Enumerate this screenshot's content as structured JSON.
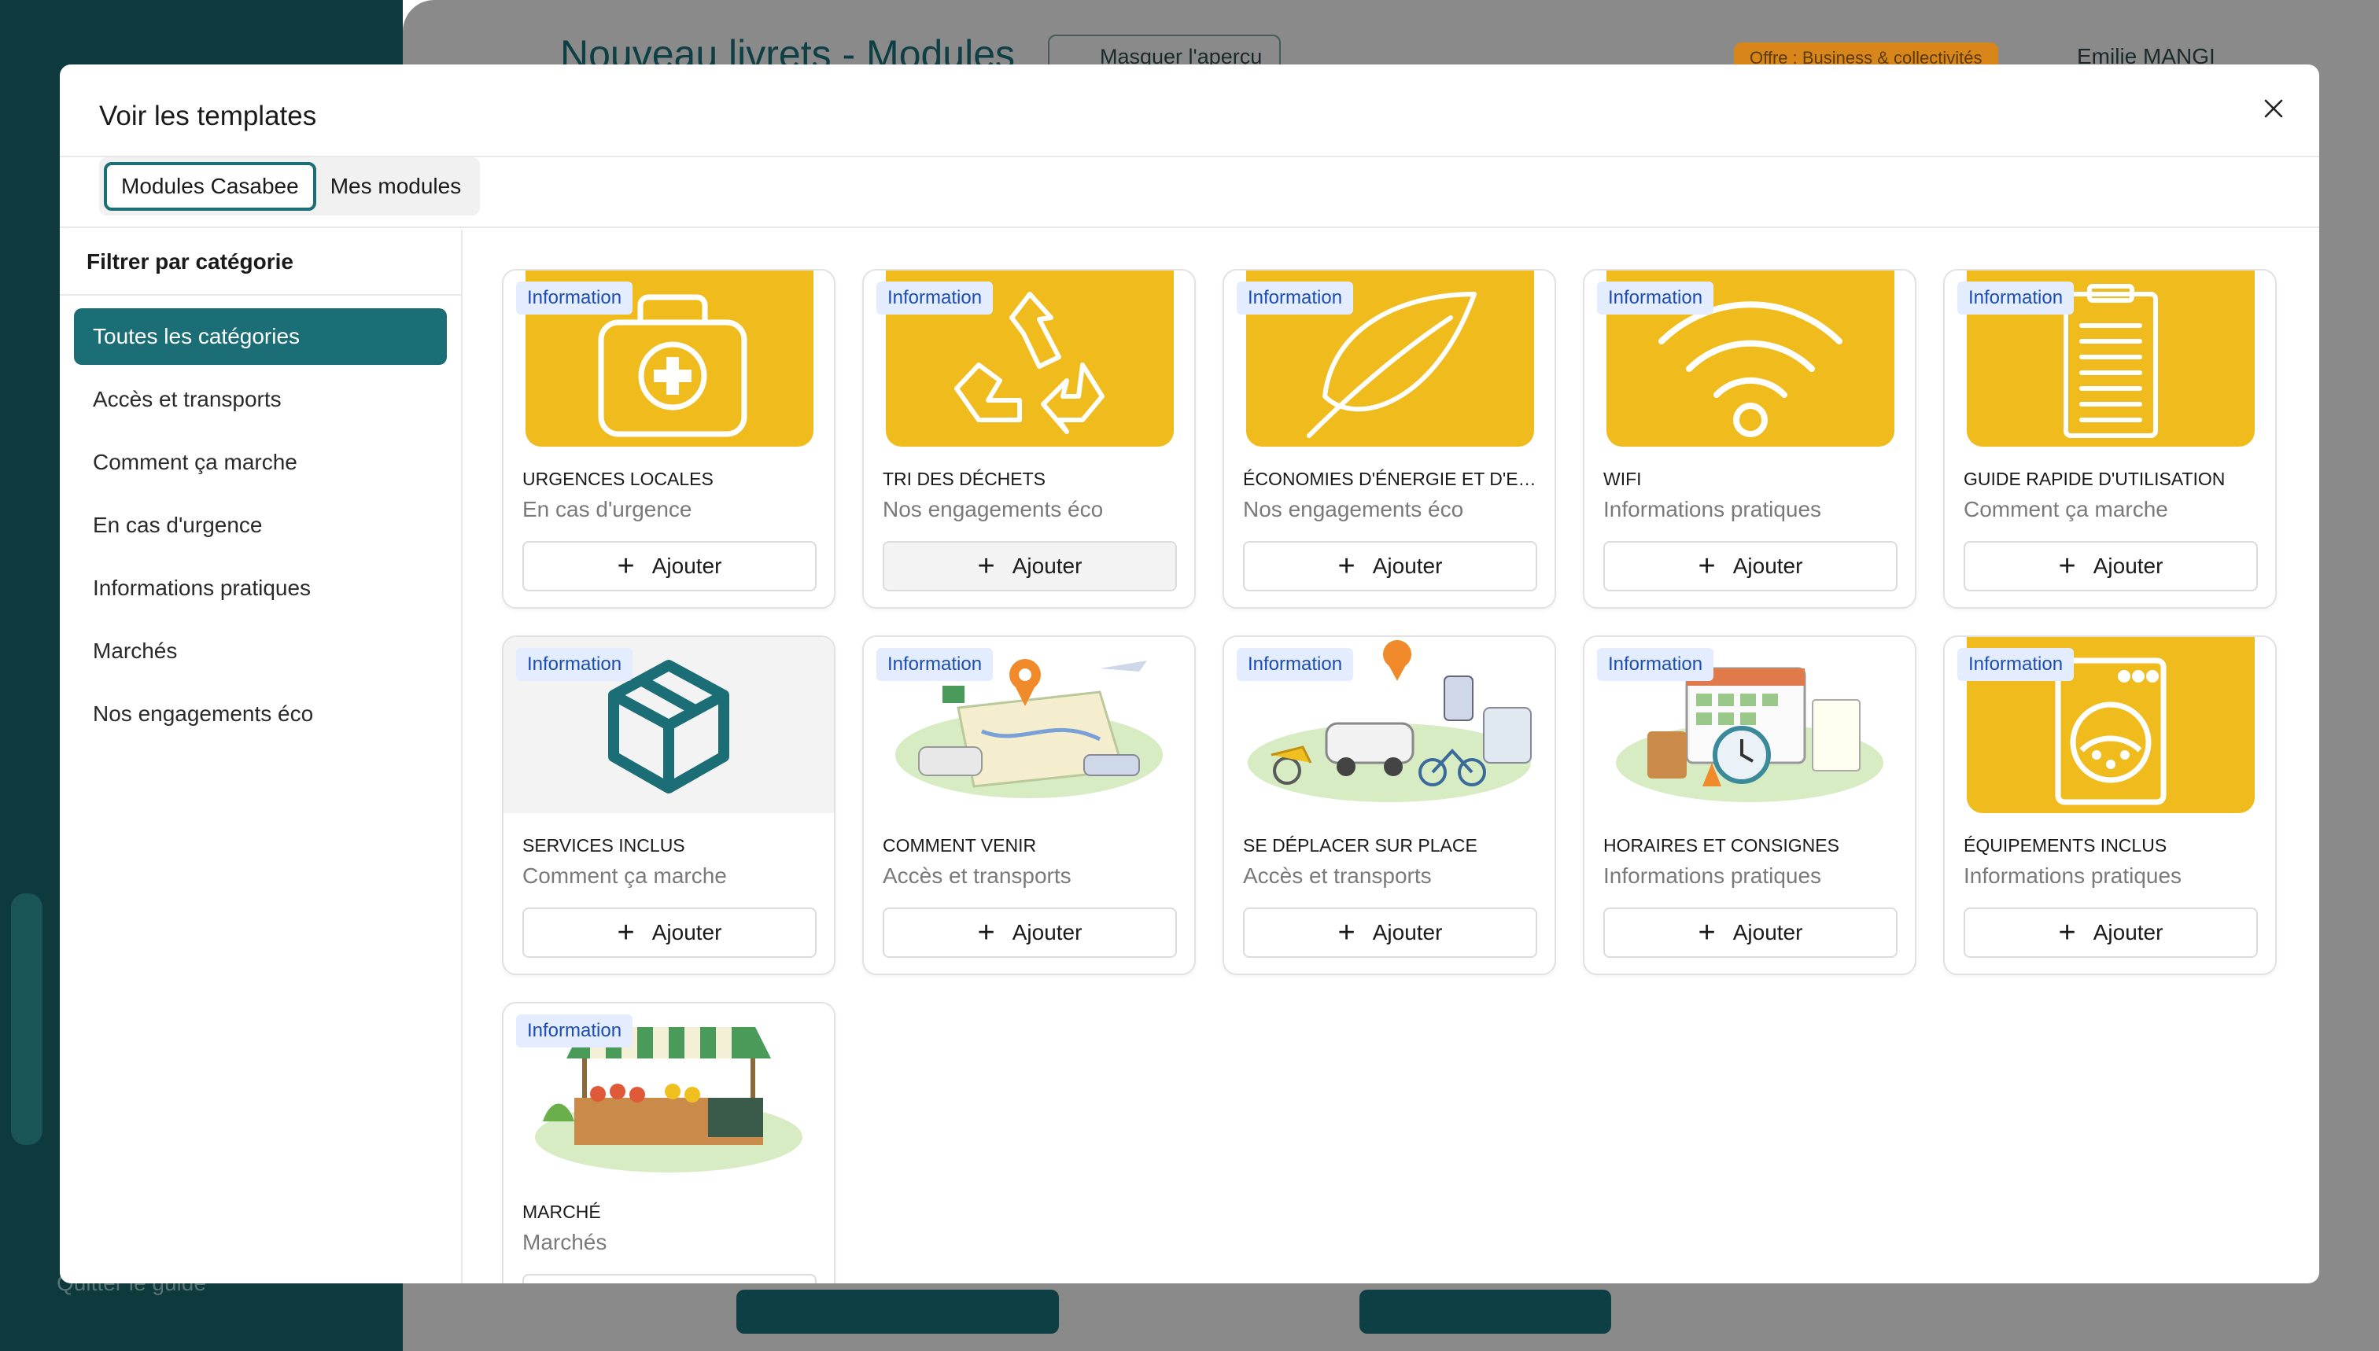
{
  "background": {
    "page_title": "Nouveau livrets - Modules",
    "hide_preview_label": "Masquer l'aperçu",
    "offer_label": "Offre : Business & collectivités",
    "user_name": "Emilie MANGI",
    "quit_label": "Quitter le guide"
  },
  "modal": {
    "title": "Voir les templates",
    "close_icon": "close-icon",
    "tabs": [
      {
        "label": "Modules Casabee",
        "active": true
      },
      {
        "label": "Mes modules",
        "active": false
      }
    ],
    "filter_title": "Filtrer par catégorie",
    "categories": [
      "Toutes les catégories",
      "Accès et transports",
      "Comment ça marche",
      "En cas d'urgence",
      "Informations pratiques",
      "Marchés",
      "Nos engagements éco"
    ],
    "active_category": "Toutes les catégories",
    "add_label": "Ajouter",
    "cards": [
      {
        "badge": "Information",
        "title": "URGENCES LOCALES",
        "category": "En cas d'urgence",
        "image": "first-aid-kit-icon"
      },
      {
        "badge": "Information",
        "title": "TRI DES DÉCHETS",
        "category": "Nos engagements éco",
        "image": "recycle-icon"
      },
      {
        "badge": "Information",
        "title": "ÉCONOMIES D'ÉNERGIE ET D'EA...",
        "category": "Nos engagements éco",
        "image": "leaf-icon"
      },
      {
        "badge": "Information",
        "title": "WIFI",
        "category": "Informations pratiques",
        "image": "wifi-icon"
      },
      {
        "badge": "Information",
        "title": "GUIDE RAPIDE D'UTILISATION",
        "category": "Comment ça marche",
        "image": "clipboard-icon"
      },
      {
        "badge": "Information",
        "title": "SERVICES INCLUS",
        "category": "Comment ça marche",
        "image": "box-icon"
      },
      {
        "badge": "Information",
        "title": "COMMENT VENIR",
        "category": "Accès et transports",
        "image": "map-travel-illustration"
      },
      {
        "badge": "Information",
        "title": "SE DÉPLACER SUR PLACE",
        "category": "Accès et transports",
        "image": "local-transport-illustration"
      },
      {
        "badge": "Information",
        "title": "HORAIRES ET CONSIGNES",
        "category": "Informations pratiques",
        "image": "schedule-illustration"
      },
      {
        "badge": "Information",
        "title": "ÉQUIPEMENTS INCLUS",
        "category": "Informations pratiques",
        "image": "washing-machine-icon"
      },
      {
        "badge": "Information",
        "title": "MARCHÉ",
        "category": "Marchés",
        "image": "market-stall-illustration"
      }
    ]
  },
  "colors": {
    "accent": "#1b6e75",
    "card_yellow": "#f0bc1d",
    "badge_bg": "#e3edff",
    "badge_text": "#1d4db0"
  }
}
